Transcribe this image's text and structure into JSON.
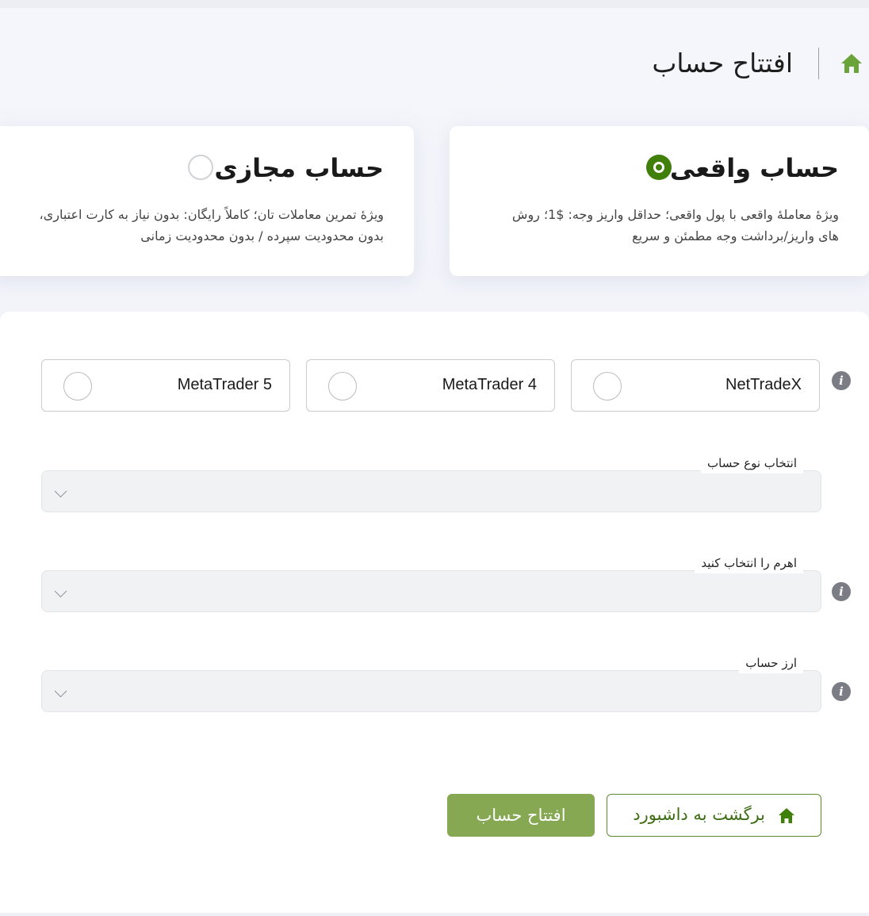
{
  "header": {
    "title": "افتتاح حساب",
    "icon": "home-icon"
  },
  "account_types": [
    {
      "title": "حساب واقعی",
      "description_line1": "ویژهٔ معاملهٔ واقعی با پول واقعی؛ حداقل واریز وجه: $1؛ روش",
      "description_line2": "های واریز/برداشت وجه مطمئن و سریع",
      "selected": true
    },
    {
      "title": "حساب مجازی",
      "description_line1": "ویژهٔ تمرین معاملات تان؛ کاملاً رایگان: بدون نیاز به کارت اعتباری،",
      "description_line2": "بدون محدودیت سپرده / بدون محدودیت زمانی",
      "selected": false
    }
  ],
  "platforms": [
    {
      "label": "NetTradeX",
      "selected": false
    },
    {
      "label": "MetaTrader 4",
      "selected": false
    },
    {
      "label": "MetaTrader 5",
      "selected": false
    }
  ],
  "fields": {
    "account_type": {
      "label": "انتخاب نوع حساب",
      "value": ""
    },
    "leverage": {
      "label": "اهرم را انتخاب کنید",
      "value": ""
    },
    "currency": {
      "label": "ارز حساب",
      "value": ""
    }
  },
  "buttons": {
    "back": "برگشت به داشبورد",
    "open": "افتتاح حساب"
  },
  "colors": {
    "accent": "#3f7f0a",
    "primary_button": "#86a853",
    "home_icon": "#6aa33a"
  }
}
